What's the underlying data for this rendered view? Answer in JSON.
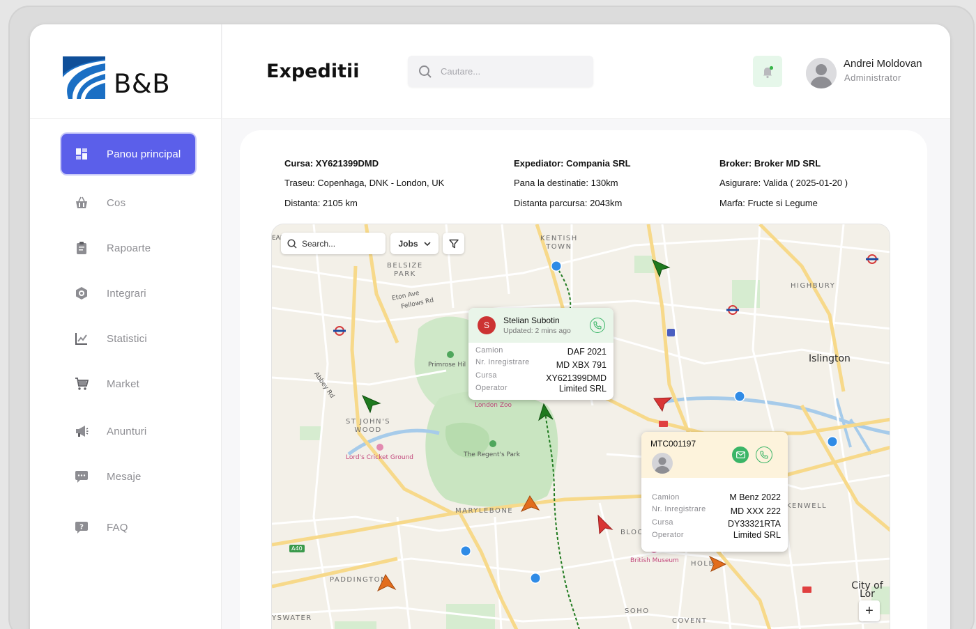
{
  "brand": {
    "name": "B&B"
  },
  "sidebar": {
    "items": [
      {
        "label": "Panou principal",
        "icon": "dashboard-icon",
        "active": true
      },
      {
        "label": "Cos",
        "icon": "basket-icon"
      },
      {
        "label": "Rapoarte",
        "icon": "clipboard-icon"
      },
      {
        "label": "Integrari",
        "icon": "integration-icon"
      },
      {
        "label": "Statistici",
        "icon": "chart-icon"
      },
      {
        "label": "Market",
        "icon": "cart-icon"
      },
      {
        "label": "Anunturi",
        "icon": "megaphone-icon"
      },
      {
        "label": "Mesaje",
        "icon": "message-icon"
      },
      {
        "label": "FAQ",
        "icon": "question-icon"
      }
    ]
  },
  "header": {
    "title": "Expeditii",
    "search_placeholder": "Cautare...",
    "user": {
      "name": "Andrei Moldovan",
      "role": "Administrator"
    }
  },
  "shipment": {
    "col1": {
      "title": "Cursa: XY621399DMD",
      "route": "Traseu: Copenhaga, DNK - London, UK",
      "distance": "Distanta: 2105 km"
    },
    "col2": {
      "title": "Expediator: Compania SRL",
      "remaining": "Pana la destinatie: 130km",
      "travelled": "Distanta parcursa: 2043km"
    },
    "col3": {
      "title": "Broker: Broker MD SRL",
      "insurance": "Asigurare: Valida ( 2025-01-20 )",
      "cargo": "Marfa: Fructe si Legume"
    }
  },
  "map": {
    "search_placeholder": "Search...",
    "jobs_label": "Jobs",
    "zoom_in": "+",
    "labels": {
      "kentish_town": "KENTISH\nTOWN",
      "belsize_park": "BELSIZE\nPARK",
      "highbury": "HIGHBURY",
      "eton_ave": "Eton Ave",
      "fellows_rd": "Fellows Rd",
      "islington": "Islington",
      "primrose_hill": "Primrose Hil",
      "abbey_rd": "Abbey Rd",
      "st_johns_wood": "ST JOHN'S\nWOOD",
      "london_zoo": "London Zoo",
      "lords": "Lord's Cricket Ground",
      "regents_park": "The Regent's Park",
      "marylebone": "MARYLEBONE",
      "a40": "A40",
      "paddington": "PADDINGTON",
      "bayswater": "YSWATER",
      "soho": "SOHO",
      "covent": "COVENT",
      "british_museum": "British Museum",
      "bloo": "BLOO",
      "holb": "HOLB",
      "kenwell": "KENWELL",
      "city_of_london": "City of Lor",
      "eai": "EAI"
    },
    "driver_popup": {
      "initial": "S",
      "name": "Stelian Subotin",
      "updated": "Updated: 2 mins ago",
      "rows": [
        {
          "k": "Camion",
          "v": "DAF 2021"
        },
        {
          "k": "Nr. Inregistrare",
          "v": "MD XBX 791"
        },
        {
          "k": "Cursa",
          "v": "XY621399DMD"
        },
        {
          "k": "Operator",
          "v": "Limited SRL"
        }
      ]
    },
    "truck_popup": {
      "id": "MTC001197",
      "rows": [
        {
          "k": "Camion",
          "v": "M Benz 2022"
        },
        {
          "k": "Nr. Inregistrare",
          "v": "MD XXX 222"
        },
        {
          "k": "Cursa",
          "v": "DY33321RTA"
        },
        {
          "k": "Operator",
          "v": "Limited SRL"
        }
      ]
    }
  },
  "colors": {
    "accent": "#5b5fea",
    "green_marker": "#1f7a1f",
    "red_marker": "#d93535",
    "orange_marker": "#e26d1d",
    "blue_dot": "#2f8be6",
    "route": "#1f7a1f"
  }
}
